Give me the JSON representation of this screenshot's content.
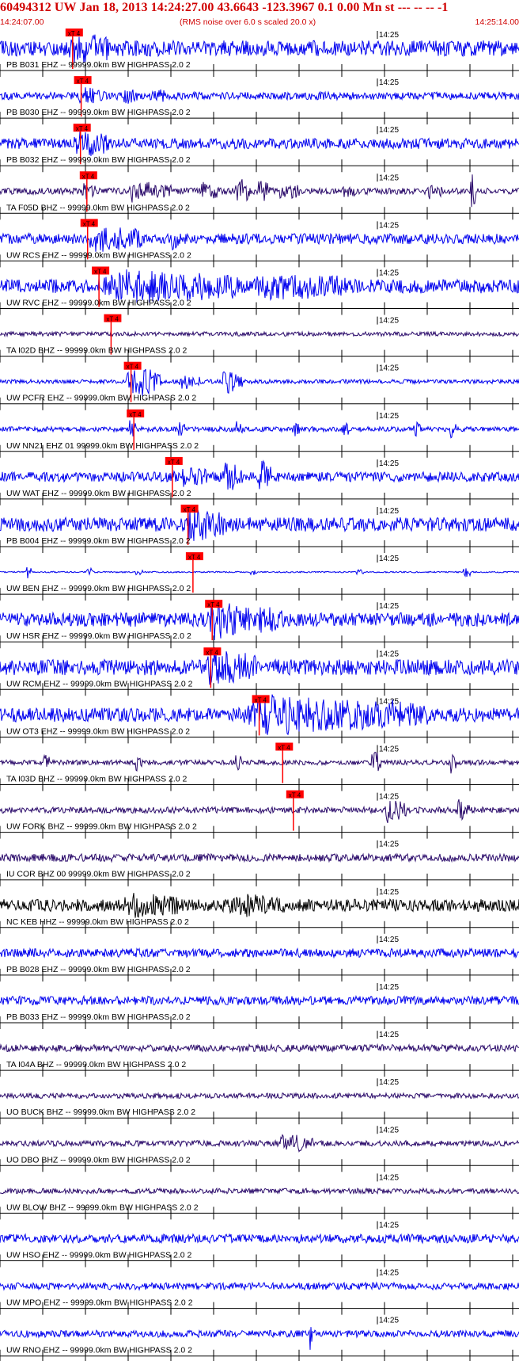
{
  "header": {
    "title": "60494312 UW Jan 18, 2013 14:24:27.00   43.6643 -123.3967  0.1 0.00 Mn st --- -- --  -1",
    "start_time": "14:24:07.00",
    "scale_note": "(RMS noise over 6.0 s scaled 20.0 x)",
    "end_time": "14:25:14.00"
  },
  "chart_data": {
    "type": "line",
    "title": "60494312 UW Jan 18, 2013 14:24:27.00   43.6643 -123.3967  0.1 0.00 Mn st --- -- --  -1",
    "x_range": [
      "14:24:07.00",
      "14:25:14.00"
    ],
    "minute_mark_label": "14:25",
    "pick_label": "xT 4",
    "colors": {
      "header_text": "#d00000",
      "pick": "#ff0000",
      "blue_trace": "#0000ee",
      "purple_trace": "#2a0a6a",
      "black_trace": "#000000",
      "tick": "#000000"
    },
    "series": [
      {
        "name": "PB B031 EHZ -- 99999.0km BW  HIGHPASS  2.0  2",
        "color": "#0000ee",
        "pick_s": 9.2,
        "amp": 0.45,
        "events": [
          [
            9.6,
            6,
            0.55
          ]
        ]
      },
      {
        "name": "PB B030 EHZ -- 99999.0km BW  HIGHPASS  2.0  2",
        "color": "#0000ee",
        "pick_s": 10.4,
        "amp": 0.22,
        "events": [
          [
            10.8,
            4,
            0.35
          ],
          [
            17,
            3,
            0.3
          ],
          [
            21,
            2,
            0.3
          ]
        ]
      },
      {
        "name": "PB B032 EHZ -- 99999.0km BW  HIGHPASS  2.0  2",
        "color": "#0000ee",
        "pick_s": 10.3,
        "amp": 0.3,
        "events": [
          [
            10.3,
            5,
            0.6
          ]
        ]
      },
      {
        "name": "TA F05D BHZ -- 99999.0km BW  HIGHPASS  2.0  2",
        "color": "#2a0a6a",
        "pick_s": 11.2,
        "amp": 0.18,
        "events": [
          [
            11.5,
            2,
            0.4
          ],
          [
            18,
            2,
            0.7
          ],
          [
            20,
            4,
            0.4
          ],
          [
            28,
            3,
            0.4
          ],
          [
            33,
            2,
            0.8
          ],
          [
            36,
            2,
            0.6
          ],
          [
            39,
            3,
            0.4
          ],
          [
            48,
            2,
            0.3
          ],
          [
            60,
            2,
            0.3
          ],
          [
            66,
            1,
            1
          ]
        ]
      },
      {
        "name": "UW RCS EHZ -- 99999.0km BW  HIGHPASS  2.0  2",
        "color": "#0000ee",
        "pick_s": 11.3,
        "amp": 0.3,
        "events": [
          [
            12,
            8,
            0.6
          ],
          [
            24,
            1,
            0.5
          ]
        ]
      },
      {
        "name": "UW RVC EHZ -- 99999.0km BW  HIGHPASS  2.0  2",
        "color": "#0000ee",
        "pick_s": 12.9,
        "amp": 0.4,
        "events": [
          [
            13.5,
            20,
            0.7
          ],
          [
            35,
            15,
            0.45
          ]
        ]
      },
      {
        "name": "TA I02D BHZ -- 99999.0km BW  HIGHPASS  2.0  2",
        "color": "#2a0a6a",
        "pick_s": 14.6,
        "amp": 0.12,
        "events": []
      },
      {
        "name": "UW PCFR EHZ -- 99999.0km BW  HIGHPASS  2.0  2",
        "color": "#0000ee",
        "pick_s": 17.4,
        "amp": 0.12,
        "events": [
          [
            17.6,
            5,
            1.0
          ],
          [
            25,
            3,
            0.4
          ],
          [
            31,
            3,
            0.7
          ]
        ]
      },
      {
        "name": "UW NN21 EHZ 01 99999.0km BW  HIGHPASS  2.0  2",
        "color": "#0000ee",
        "pick_s": 17.8,
        "amp": 0.14,
        "events": [
          [
            18,
            1,
            0.5
          ],
          [
            25,
            1,
            0.4
          ],
          [
            33,
            1,
            0.4
          ],
          [
            41,
            1,
            0.4
          ],
          [
            48,
            1,
            0.4
          ],
          [
            58,
            1,
            0.4
          ],
          [
            63,
            1,
            0.5
          ]
        ]
      },
      {
        "name": "UW WAT EHZ -- 99999.0km BW  HIGHPASS  2.0  2",
        "color": "#0000ee",
        "pick_s": 23.2,
        "amp": 0.28,
        "events": [
          [
            24,
            5,
            0.4
          ],
          [
            31,
            3,
            0.8
          ],
          [
            36,
            2,
            1.0
          ]
        ]
      },
      {
        "name": "PB B004 EHZ -- 99999.0km BW  HIGHPASS  2.0  2",
        "color": "#0000ee",
        "pick_s": 25.4,
        "amp": 0.4,
        "events": [
          [
            25.8,
            6,
            0.7
          ]
        ]
      },
      {
        "name": "UW BEN EHZ -- 99999.0km BW  HIGHPASS  2.0  2",
        "color": "#0000ee",
        "pick_s": 26.1,
        "amp": 0.04,
        "events": [
          [
            3.5,
            1,
            0.5
          ],
          [
            12,
            1,
            0.4
          ],
          [
            19,
            1,
            0.3
          ],
          [
            35,
            1,
            0.35
          ],
          [
            50,
            1,
            0.3
          ],
          [
            65,
            1,
            0.5
          ]
        ]
      },
      {
        "name": "UW HSR EHZ -- 99999.0km BW  HIGHPASS  2.0  2",
        "color": "#0000ee",
        "pick_s": 28.8,
        "amp": 0.4,
        "events": [
          [
            29,
            6,
            0.9
          ],
          [
            36,
            4,
            0.5
          ]
        ]
      },
      {
        "name": "UW RCM EHZ -- 99999.0km BW  HIGHPASS  2.0  2",
        "color": "#0000ee",
        "pick_s": 28.6,
        "amp": 0.45,
        "events": [
          [
            29,
            4,
            1.0
          ],
          [
            33,
            3,
            0.6
          ]
        ]
      },
      {
        "name": "UW OT3 EHZ -- 99999.0km BW  HIGHPASS  2.0  2",
        "color": "#0000ee",
        "pick_s": 35.4,
        "amp": 0.4,
        "events": [
          [
            34,
            20,
            0.9
          ],
          [
            54,
            6,
            0.55
          ]
        ]
      },
      {
        "name": "TA I03D BHZ -- 99999.0km BW  HIGHPASS  2.0  2",
        "color": "#2a0a6a",
        "pick_s": 38.7,
        "amp": 0.14,
        "events": [
          [
            6,
            1,
            0.6
          ],
          [
            19,
            1,
            0.6
          ],
          [
            33,
            1,
            0.5
          ],
          [
            52,
            1.5,
            0.8
          ],
          [
            63,
            1,
            0.7
          ]
        ]
      },
      {
        "name": "UW FORK BHZ -- 99999.0km BW  HIGHPASS  2.0  2",
        "color": "#2a0a6a",
        "pick_s": 40.2,
        "amp": 0.18,
        "events": [
          [
            54,
            3,
            0.7
          ],
          [
            64,
            2,
            0.55
          ]
        ]
      },
      {
        "name": "IU COR BHZ 00 99999.0km BW  HIGHPASS  2.0  2",
        "color": "#2a0a6a",
        "pick_s": null,
        "amp": 0.22,
        "events": []
      },
      {
        "name": "NC KEB HHZ -- 99999.0km BW  HIGHPASS  2.0  2",
        "color": "#000000",
        "pick_s": null,
        "amp": 0.35,
        "events": [
          [
            17,
            8,
            0.45
          ],
          [
            32,
            8,
            0.4
          ]
        ]
      },
      {
        "name": "PB B028 EHZ -- 99999.0km BW  HIGHPASS  2.0  2",
        "color": "#0000ee",
        "pick_s": null,
        "amp": 0.25,
        "events": []
      },
      {
        "name": "PB B033 EHZ -- 99999.0km BW  HIGHPASS  2.0  2",
        "color": "#0000ee",
        "pick_s": null,
        "amp": 0.25,
        "events": []
      },
      {
        "name": "TA I04A BHZ -- 99999.0km BW  HIGHPASS  2.0  2",
        "color": "#2a0a6a",
        "pick_s": null,
        "amp": 0.2,
        "events": []
      },
      {
        "name": "UO BUCK BHZ -- 99999.0km BW  HIGHPASS  2.0  2",
        "color": "#2a0a6a",
        "pick_s": null,
        "amp": 0.15,
        "events": []
      },
      {
        "name": "UO DBO BHZ -- 99999.0km BW  HIGHPASS  2.0  2",
        "color": "#2a0a6a",
        "pick_s": null,
        "amp": 0.16,
        "events": [
          [
            39,
            5,
            0.5
          ]
        ]
      },
      {
        "name": "UW BLOW BHZ -- 99999.0km BW  HIGHPASS  2.0  2",
        "color": "#2a0a6a",
        "pick_s": null,
        "amp": 0.15,
        "events": []
      },
      {
        "name": "UW HSO EHZ -- 99999.0km BW  HIGHPASS  2.0  2",
        "color": "#0000ee",
        "pick_s": null,
        "amp": 0.25,
        "events": []
      },
      {
        "name": "UW MPO EHZ -- 99999.0km BW  HIGHPASS  2.0  2",
        "color": "#0000ee",
        "pick_s": null,
        "amp": 0.2,
        "events": []
      },
      {
        "name": "UW RNO EHZ -- 99999.0km BW  HIGHPASS  2.0  2",
        "color": "#0000ee",
        "pick_s": null,
        "amp": 0.2,
        "events": [
          [
            43.5,
            0.4,
            1.0
          ],
          [
            43.9,
            0.4,
            0.5
          ]
        ]
      }
    ]
  }
}
